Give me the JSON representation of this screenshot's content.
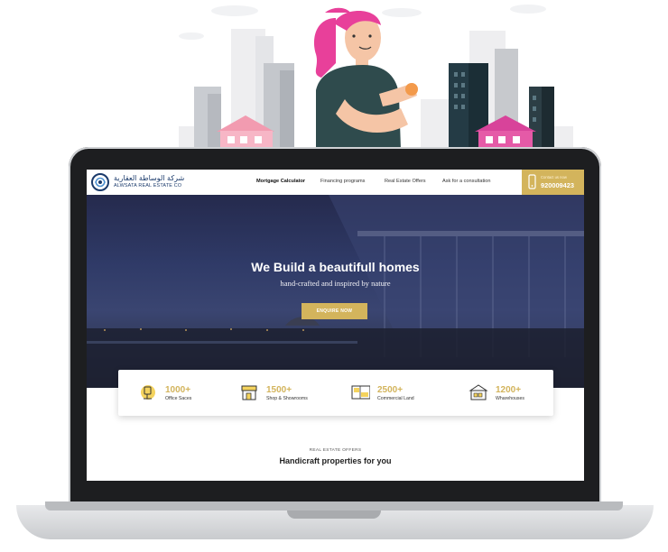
{
  "brand": {
    "name_ar": "شركة الوساطة العقارية",
    "name_en": "ALWSATA REAL ESTATE CO"
  },
  "nav": {
    "items": [
      {
        "label": "Mortgage Calculator",
        "active": true
      },
      {
        "label": "Financing programs",
        "active": false
      },
      {
        "label": "Real Estate Offers",
        "active": false
      },
      {
        "label": "Ask for a consultation",
        "active": false
      }
    ],
    "contact_label": "Contact us now",
    "contact_number": "920009423"
  },
  "hero": {
    "title": "We Build a beautifull homes",
    "subtitle": "hand-crafted and inspired by nature",
    "cta": "ENQUIRE NOW"
  },
  "stats": [
    {
      "number": "1000+",
      "label": "Office Saces",
      "icon": "office-chair-icon"
    },
    {
      "number": "1500+",
      "label": "Shop & Showrooms",
      "icon": "shop-icon"
    },
    {
      "number": "2500+",
      "label": "Commercial Land",
      "icon": "land-map-icon"
    },
    {
      "number": "1200+",
      "label": "Wharehouses",
      "icon": "warehouse-icon"
    }
  ],
  "section": {
    "eyebrow": "REAL ESTATE OFFERS",
    "title": "Handicraft properties for you"
  },
  "colors": {
    "accent": "#d3b45c",
    "navy": "#1a3a6b",
    "hero_dark": "#252a4d",
    "house_pink": "#f5a3b5",
    "hair_pink": "#e8409a"
  }
}
